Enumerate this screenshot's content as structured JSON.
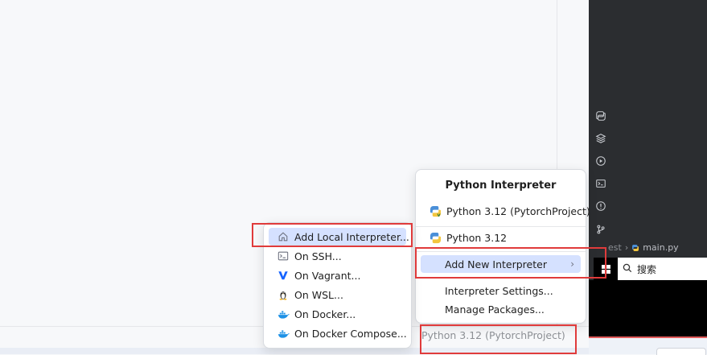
{
  "breadcrumb": {
    "project": "est",
    "file": "main.py"
  },
  "search": {
    "label": "搜索"
  },
  "interpreter_popup": {
    "title": "Python Interpreter",
    "current_interpreter": "Python 3.12 (PytorchProject)",
    "other_interpreter": "Python 3.12",
    "add_new": "Add New Interpreter",
    "settings": "Interpreter Settings...",
    "manage_packages": "Manage Packages..."
  },
  "add_submenu": {
    "items": [
      {
        "label": "Add Local Interpreter...",
        "icon": "home-icon"
      },
      {
        "label": "On SSH...",
        "icon": "terminal-icon"
      },
      {
        "label": "On Vagrant...",
        "icon": "vagrant-icon"
      },
      {
        "label": "On WSL...",
        "icon": "linux-icon"
      },
      {
        "label": "On Docker...",
        "icon": "docker-icon"
      },
      {
        "label": "On Docker Compose...",
        "icon": "docker-icon"
      }
    ]
  },
  "status_bar": {
    "interpreter": "Python 3.12 (PytorchProject)"
  },
  "colors": {
    "highlight_red": "#e03b3b",
    "selection_blue": "#d5e1ff",
    "dark_panel": "#2b2d30"
  }
}
